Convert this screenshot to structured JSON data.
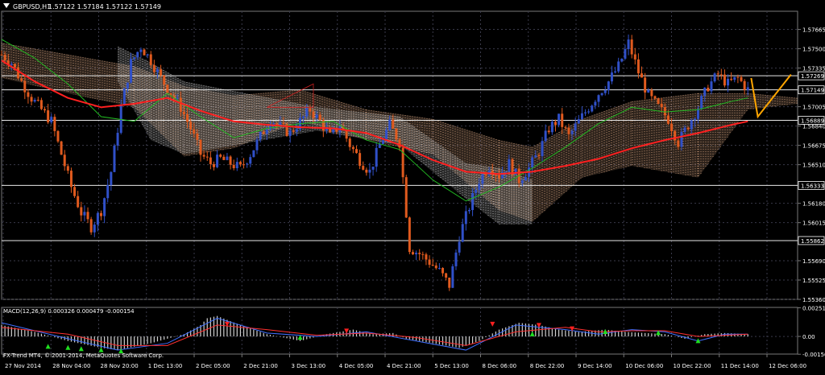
{
  "header": {
    "symbol": "GBPUSD,H1",
    "ohlc": "1.57122 1.57184 1.57122 1.57149"
  },
  "macd_label": "MACD(12,26,9) 0.000326 0.000479 -0.000154",
  "copyright": "FX-Trend MT4, © 2001-2014, MetaQuotes Software Corp.",
  "colors": {
    "background": "#000000",
    "grid": "#3a3a4a",
    "axis_text": "#ffffff",
    "bull_candle": "#3050c8",
    "bear_candle": "#e05a1e",
    "ma_red": "#ff2020",
    "ma_green": "#22b822",
    "cloud_peach": "#f0b890",
    "cloud_white": "#d8d8d8",
    "forecast": "#ffa500",
    "macd_hist": "#d0d0d0",
    "macd_line": "#3f6fff",
    "macd_signal": "#ff3030"
  },
  "chart_data": [
    {
      "type": "candlestick",
      "ylim": [
        1.5536,
        1.5782
      ],
      "y_ticks": [
        "1.57665",
        "1.57500",
        "1.57335",
        "1.57005",
        "1.56840",
        "1.56675",
        "1.56510",
        "1.56180",
        "1.56015",
        "1.55690",
        "1.55525",
        "1.55360"
      ],
      "y_tick_values": [
        1.57665,
        1.575,
        1.57335,
        1.57005,
        1.5684,
        1.56675,
        1.5651,
        1.5618,
        1.56015,
        1.5569,
        1.55525,
        1.5536
      ],
      "x_labels": [
        "27 Nov 2014",
        "28 Nov 04:00",
        "28 Nov 20:00",
        "1 Dec 13:00",
        "2 Dec 05:00",
        "2 Dec 21:00",
        "3 Dec 13:00",
        "4 Dec 05:00",
        "4 Dec 21:00",
        "5 Dec 13:00",
        "8 Dec 06:00",
        "8 Dec 22:00",
        "9 Dec 14:00",
        "10 Dec 06:00",
        "10 Dec 22:00",
        "11 Dec 14:00",
        "12 Dec 06:00"
      ],
      "horizontal_levels": [
        {
          "label": "1.57269",
          "value": 1.57269
        },
        {
          "label": "1.57149",
          "value": 1.57149
        },
        {
          "label": "1.56889",
          "value": 1.56889
        },
        {
          "label": "1.56333",
          "value": 1.56333
        },
        {
          "label": "1.55862",
          "value": 1.55862
        }
      ],
      "close_path": [
        [
          0,
          1.5745
        ],
        [
          3,
          1.5738
        ],
        [
          6,
          1.5722
        ],
        [
          9,
          1.5708
        ],
        [
          12,
          1.5698
        ],
        [
          15,
          1.5688
        ],
        [
          18,
          1.566
        ],
        [
          21,
          1.5632
        ],
        [
          24,
          1.561
        ],
        [
          27,
          1.5598
        ],
        [
          30,
          1.5612
        ],
        [
          33,
          1.5645
        ],
        [
          36,
          1.57
        ],
        [
          39,
          1.5738
        ],
        [
          42,
          1.5752
        ],
        [
          45,
          1.574
        ],
        [
          48,
          1.5725
        ],
        [
          51,
          1.5712
        ],
        [
          54,
          1.57
        ],
        [
          57,
          1.5682
        ],
        [
          60,
          1.566
        ],
        [
          63,
          1.5652
        ],
        [
          66,
          1.5656
        ],
        [
          69,
          1.5652
        ],
        [
          72,
          1.5648
        ],
        [
          75,
          1.566
        ],
        [
          78,
          1.5675
        ],
        [
          81,
          1.569
        ],
        [
          84,
          1.5683
        ],
        [
          87,
          1.5678
        ],
        [
          90,
          1.5688
        ],
        [
          93,
          1.5698
        ],
        [
          96,
          1.5688
        ],
        [
          99,
          1.5675
        ],
        [
          102,
          1.5685
        ],
        [
          105,
          1.5668
        ],
        [
          108,
          1.5655
        ],
        [
          111,
          1.5645
        ],
        [
          114,
          1.5668
        ],
        [
          117,
          1.5685
        ],
        [
          120,
          1.567
        ],
        [
          123,
          1.558
        ],
        [
          126,
          1.5575
        ],
        [
          129,
          1.5568
        ],
        [
          132,
          1.556
        ],
        [
          135,
          1.5548
        ],
        [
          138,
          1.559
        ],
        [
          141,
          1.5615
        ],
        [
          144,
          1.5638
        ],
        [
          147,
          1.565
        ],
        [
          150,
          1.5642
        ],
        [
          153,
          1.5652
        ],
        [
          156,
          1.5638
        ],
        [
          159,
          1.5648
        ],
        [
          162,
          1.5662
        ],
        [
          165,
          1.5682
        ],
        [
          168,
          1.569
        ],
        [
          171,
          1.5675
        ],
        [
          174,
          1.5688
        ],
        [
          177,
          1.57
        ],
        [
          180,
          1.5712
        ],
        [
          183,
          1.5722
        ],
        [
          186,
          1.5735
        ],
        [
          189,
          1.5755
        ],
        [
          192,
          1.573
        ],
        [
          195,
          1.571
        ],
        [
          198,
          1.57
        ],
        [
          201,
          1.569
        ],
        [
          204,
          1.567
        ],
        [
          207,
          1.5685
        ],
        [
          210,
          1.57
        ],
        [
          213,
          1.5718
        ],
        [
          216,
          1.5728
        ],
        [
          219,
          1.572
        ],
        [
          222,
          1.5725
        ],
        [
          225,
          1.5715
        ]
      ],
      "ma_red": [
        [
          0,
          1.574
        ],
        [
          10,
          1.5722
        ],
        [
          20,
          1.5708
        ],
        [
          30,
          1.57
        ],
        [
          40,
          1.5703
        ],
        [
          50,
          1.5708
        ],
        [
          60,
          1.5697
        ],
        [
          70,
          1.5688
        ],
        [
          80,
          1.5685
        ],
        [
          90,
          1.5683
        ],
        [
          100,
          1.5682
        ],
        [
          110,
          1.5678
        ],
        [
          120,
          1.5668
        ],
        [
          130,
          1.5655
        ],
        [
          140,
          1.5645
        ],
        [
          150,
          1.5643
        ],
        [
          160,
          1.5645
        ],
        [
          170,
          1.565
        ],
        [
          180,
          1.5656
        ],
        [
          190,
          1.5665
        ],
        [
          200,
          1.5672
        ],
        [
          210,
          1.5678
        ],
        [
          220,
          1.5685
        ],
        [
          225,
          1.5688
        ]
      ],
      "ma_green": [
        [
          0,
          1.5758
        ],
        [
          10,
          1.5742
        ],
        [
          20,
          1.572
        ],
        [
          30,
          1.5692
        ],
        [
          40,
          1.5688
        ],
        [
          50,
          1.5712
        ],
        [
          60,
          1.5692
        ],
        [
          70,
          1.5674
        ],
        [
          80,
          1.5682
        ],
        [
          90,
          1.5686
        ],
        [
          100,
          1.5688
        ],
        [
          110,
          1.5672
        ],
        [
          120,
          1.5664
        ],
        [
          130,
          1.5638
        ],
        [
          140,
          1.562
        ],
        [
          150,
          1.5632
        ],
        [
          160,
          1.5648
        ],
        [
          170,
          1.5666
        ],
        [
          180,
          1.5686
        ],
        [
          190,
          1.57
        ],
        [
          200,
          1.5696
        ],
        [
          210,
          1.5698
        ],
        [
          220,
          1.5705
        ],
        [
          225,
          1.5708
        ]
      ],
      "cloud_peach": [
        [
          0,
          1.5755,
          1.5725
        ],
        [
          20,
          1.5745,
          1.5712
        ],
        [
          40,
          1.5735,
          1.57
        ],
        [
          55,
          1.5718,
          1.5658
        ],
        [
          70,
          1.571,
          1.5665
        ],
        [
          90,
          1.5715,
          1.5688
        ],
        [
          110,
          1.5698,
          1.5672
        ],
        [
          130,
          1.569,
          1.566
        ],
        [
          150,
          1.5672,
          1.5612
        ],
        [
          160,
          1.5666,
          1.5602
        ],
        [
          175,
          1.569,
          1.564
        ],
        [
          190,
          1.5705,
          1.565
        ],
        [
          210,
          1.5712,
          1.564
        ],
        [
          225,
          1.5712,
          1.5698
        ],
        [
          240,
          1.5708,
          1.5703
        ]
      ],
      "cloud_white": [
        [
          35,
          1.5752,
          1.5722
        ],
        [
          45,
          1.5738,
          1.5672
        ],
        [
          55,
          1.5722,
          1.566
        ],
        [
          95,
          1.57,
          1.568
        ],
        [
          120,
          1.5692,
          1.5668
        ],
        [
          140,
          1.5652,
          1.5622
        ],
        [
          150,
          1.5648,
          1.56
        ],
        [
          160,
          1.5638,
          1.56
        ]
      ],
      "forecast": [
        [
          226,
          1.5725
        ],
        [
          228,
          1.5692
        ],
        [
          238,
          1.5728
        ]
      ],
      "triangle": [
        [
          80,
          1.57
        ],
        [
          94,
          1.572
        ],
        [
          94,
          1.57
        ]
      ]
    },
    {
      "type": "bar",
      "name": "MACD(12,26,9)",
      "ylim": [
        -0.00155,
        0.00255
      ],
      "y_ticks": [
        "0.002518",
        "0.00",
        "-0.001564"
      ],
      "y_tick_values": [
        0.002518,
        0.0,
        -0.001564
      ],
      "histogram": [
        [
          0,
          0.001
        ],
        [
          10,
          0.0004
        ],
        [
          20,
          -0.0004
        ],
        [
          30,
          -0.001
        ],
        [
          35,
          -0.0012
        ],
        [
          45,
          -0.0006
        ],
        [
          55,
          0.0002
        ],
        [
          60,
          0.001
        ],
        [
          62,
          0.0016
        ],
        [
          65,
          0.0018
        ],
        [
          72,
          0.001
        ],
        [
          80,
          0.0002
        ],
        [
          90,
          -0.0004
        ],
        [
          98,
          0.0002
        ],
        [
          106,
          0.0006
        ],
        [
          112,
          0.0002
        ],
        [
          118,
          0.0003
        ],
        [
          122,
          -0.0002
        ],
        [
          130,
          -0.0006
        ],
        [
          138,
          -0.001
        ],
        [
          144,
          -0.0004
        ],
        [
          150,
          0.0006
        ],
        [
          156,
          0.0012
        ],
        [
          162,
          0.001
        ],
        [
          168,
          0.0006
        ],
        [
          174,
          0.0004
        ],
        [
          182,
          0.0006
        ],
        [
          188,
          0.0004
        ],
        [
          194,
          0.0003
        ],
        [
          200,
          0.0002
        ],
        [
          206,
          -0.0002
        ],
        [
          212,
          0.0002
        ],
        [
          218,
          0.0003
        ],
        [
          225,
          0.0002
        ]
      ],
      "macd_line": [
        [
          0,
          0.0012
        ],
        [
          20,
          -0.0002
        ],
        [
          35,
          -0.0012
        ],
        [
          50,
          -0.0006
        ],
        [
          65,
          0.0016
        ],
        [
          80,
          0.0003
        ],
        [
          95,
          0.0
        ],
        [
          110,
          0.0004
        ],
        [
          125,
          -0.0004
        ],
        [
          140,
          -0.0012
        ],
        [
          155,
          0.001
        ],
        [
          170,
          0.0006
        ],
        [
          180,
          0.0002
        ],
        [
          190,
          0.0006
        ],
        [
          200,
          0.0004
        ],
        [
          210,
          -0.0004
        ],
        [
          218,
          0.0002
        ],
        [
          225,
          0.0002
        ]
      ],
      "signal_line": [
        [
          0,
          0.0008
        ],
        [
          20,
          0.0002
        ],
        [
          35,
          -0.0008
        ],
        [
          50,
          -0.0008
        ],
        [
          65,
          0.001
        ],
        [
          80,
          0.0006
        ],
        [
          95,
          0.0001
        ],
        [
          110,
          0.0003
        ],
        [
          125,
          -0.0001
        ],
        [
          140,
          -0.0008
        ],
        [
          155,
          0.0004
        ],
        [
          170,
          0.0008
        ],
        [
          180,
          0.0004
        ],
        [
          190,
          0.0005
        ],
        [
          200,
          0.0005
        ],
        [
          210,
          0.0
        ],
        [
          218,
          0.0001
        ],
        [
          225,
          0.0002
        ]
      ],
      "arrows_up": [
        [
          14,
          -0.0008
        ],
        [
          20,
          -0.0009
        ],
        [
          24,
          -0.001
        ],
        [
          30,
          -0.0011
        ],
        [
          36,
          -0.0012
        ],
        [
          90,
          0.0
        ],
        [
          160,
          0.0003
        ],
        [
          182,
          0.0005
        ],
        [
          198,
          0.0004
        ],
        [
          210,
          -0.0003
        ]
      ],
      "arrows_down": [
        [
          68,
          0.001
        ],
        [
          104,
          0.0004
        ],
        [
          148,
          0.001
        ],
        [
          162,
          0.0009
        ],
        [
          172,
          0.0006
        ]
      ]
    }
  ]
}
